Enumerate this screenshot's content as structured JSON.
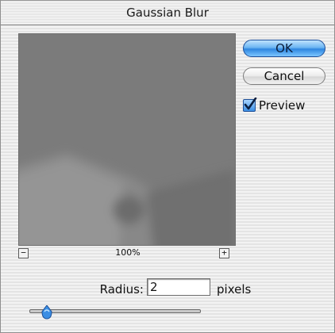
{
  "window": {
    "title": "Gaussian Blur"
  },
  "buttons": {
    "ok_label": "OK",
    "cancel_label": "Cancel"
  },
  "preview_checkbox": {
    "label": "Preview",
    "checked": true
  },
  "zoom": {
    "level": "100%",
    "zoom_out_glyph": "−",
    "zoom_in_glyph": "+"
  },
  "radius": {
    "label": "Radius:",
    "value": "2",
    "units": "pixels",
    "slider_position_fraction": 0.1
  },
  "colors": {
    "accent": "#3b8ee4",
    "preview_fill": "#7a7a7a"
  }
}
